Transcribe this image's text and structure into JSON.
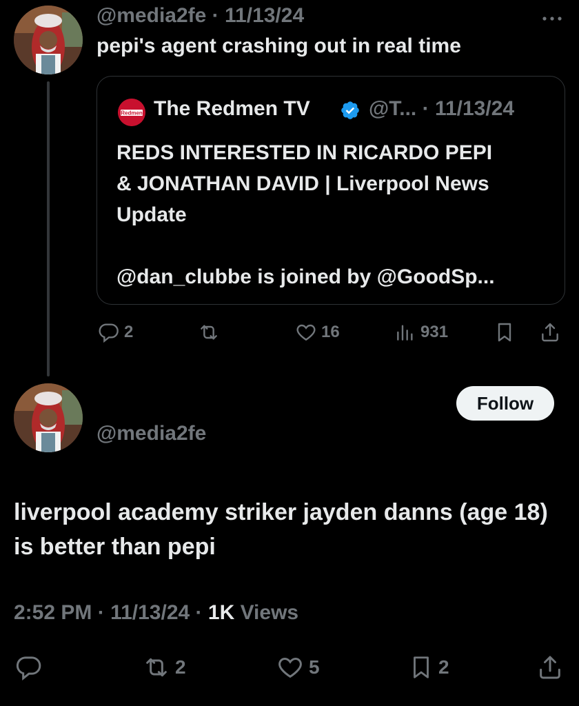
{
  "parent_tweet": {
    "handle": "@media2fe",
    "separator": "·",
    "date": "11/13/24",
    "text": "pepi's agent crashing out in real time",
    "more_icon": "more-horizontal-icon"
  },
  "quote": {
    "logo_text": "Redmen",
    "name": "The Redmen TV",
    "handle": "@T...",
    "separator": "·",
    "date": "11/13/24",
    "body": "REDS INTERESTED IN RICARDO PEPI\n& JONATHAN DAVID | Liverpool News\nUpdate\n\n@dan_clubbe is joined by @GoodSp..."
  },
  "parent_actions": {
    "replies": "2",
    "reposts": "",
    "likes": "16",
    "views": "931"
  },
  "reply_tweet": {
    "handle": "@media2fe",
    "follow_label": "Follow",
    "text": "liverpool academy striker jayden danns (age 18) is better than pepi",
    "time": "2:52 PM",
    "separator1": "·",
    "date": "11/13/24",
    "separator2": "·",
    "views_count": "1K",
    "views_label": "Views"
  },
  "reply_actions": {
    "replies": "",
    "reposts": "2",
    "likes": "5",
    "bookmarks": "2"
  },
  "colors": {
    "background": "#000000",
    "text": "#e7e9ea",
    "muted": "#71767b",
    "border": "#2f3336",
    "verified": "#1d9bf0",
    "redmen_red": "#c8102e"
  }
}
